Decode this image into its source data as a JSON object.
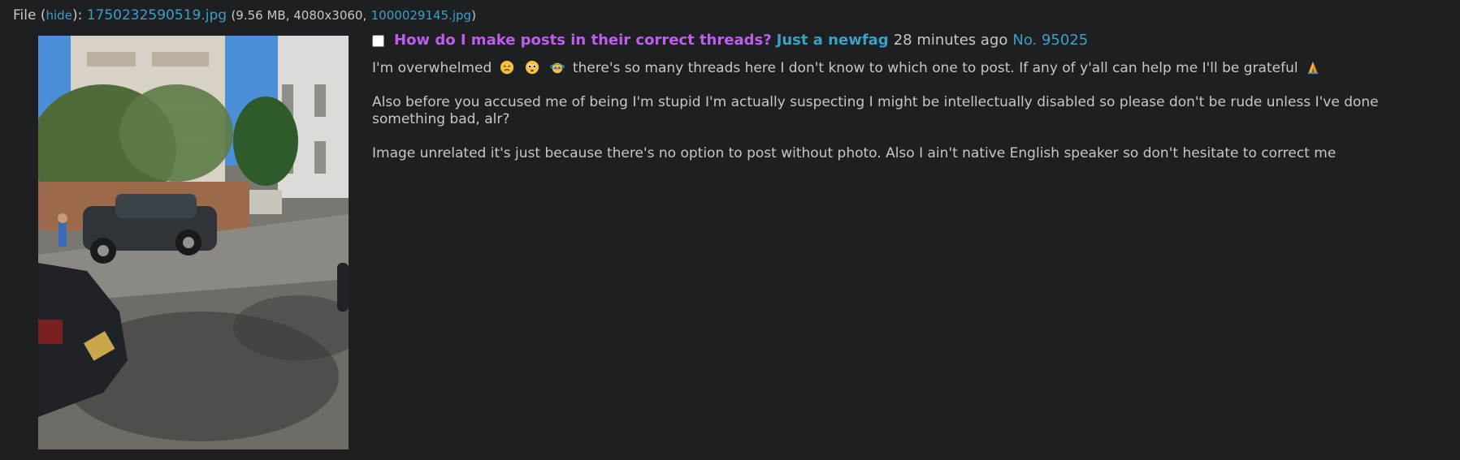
{
  "file": {
    "label": "File",
    "paren_open": " (",
    "hide_label": "hide",
    "paren_close_colon": "):",
    "filename": "1750232590519.jpg",
    "meta_prefix": "(9.56 MB, 4080x3060,",
    "original_name": "1000029145.jpg",
    "meta_suffix": ")"
  },
  "post": {
    "subject": "How do I make posts in their correct threads?",
    "name": "Just a newfag",
    "date": "28 minutes ago",
    "number": "No. 95025",
    "line1_before": "I'm overwhelmed",
    "line1_after": "there's so many threads here I don't know to which one to post. If any of y'all can help me I'll be grateful",
    "paragraph2": "Also before you accused me of being I'm stupid I'm actually suspecting I might be intellectually disabled so please don't be rude unless I've done something bad, alr?",
    "paragraph3": "Image unrelated it's just because there's no option to post without photo. Also I ain't native English speaker so don't hesitate to correct me"
  },
  "icons": {
    "emoji1": "disappointed-face-icon",
    "emoji2": "pleading-face-icon",
    "emoji3": "dizzy-face-icon",
    "emoji4": "folded-hands-icon"
  },
  "colors": {
    "background": "#1d1f21",
    "text": "#c5c8c6",
    "link": "#3aa0c8",
    "subject": "#c15cf0"
  }
}
